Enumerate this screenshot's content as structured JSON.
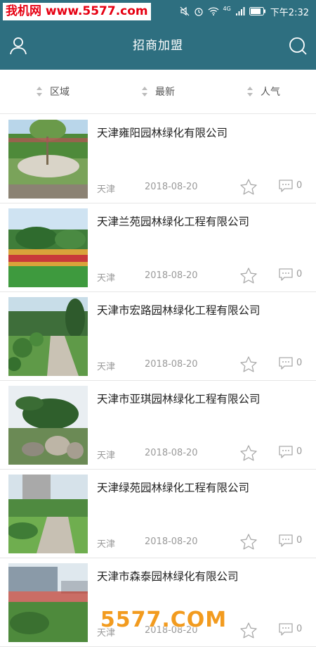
{
  "watermark": {
    "text": "我机网 www.5577.com"
  },
  "status_bar": {
    "time": "下午2:32",
    "network": "4G"
  },
  "header": {
    "title": "招商加盟"
  },
  "filters": [
    {
      "label": "区域"
    },
    {
      "label": "最新"
    },
    {
      "label": "人气"
    }
  ],
  "listings": [
    {
      "name": "天津雍阳园林绿化有限公司",
      "city": "天津",
      "date": "2018-08-20",
      "comments": "0"
    },
    {
      "name": "天津兰苑园林绿化工程有限公司",
      "city": "天津",
      "date": "2018-08-20",
      "comments": "0"
    },
    {
      "name": "天津市宏路园林绿化工程有限公司",
      "city": "天津",
      "date": "2018-08-20",
      "comments": "0"
    },
    {
      "name": "天津市亚琪园林绿化工程有限公司",
      "city": "天津",
      "date": "2018-08-20",
      "comments": "0"
    },
    {
      "name": "天津绿苑园林绿化工程有限公司",
      "city": "天津",
      "date": "2018-08-20",
      "comments": "0"
    },
    {
      "name": "天津市森泰园林绿化有限公司",
      "city": "天津",
      "date": "2018-08-20",
      "comments": "0"
    }
  ],
  "bottom_logo": {
    "text": "5577.COM"
  }
}
